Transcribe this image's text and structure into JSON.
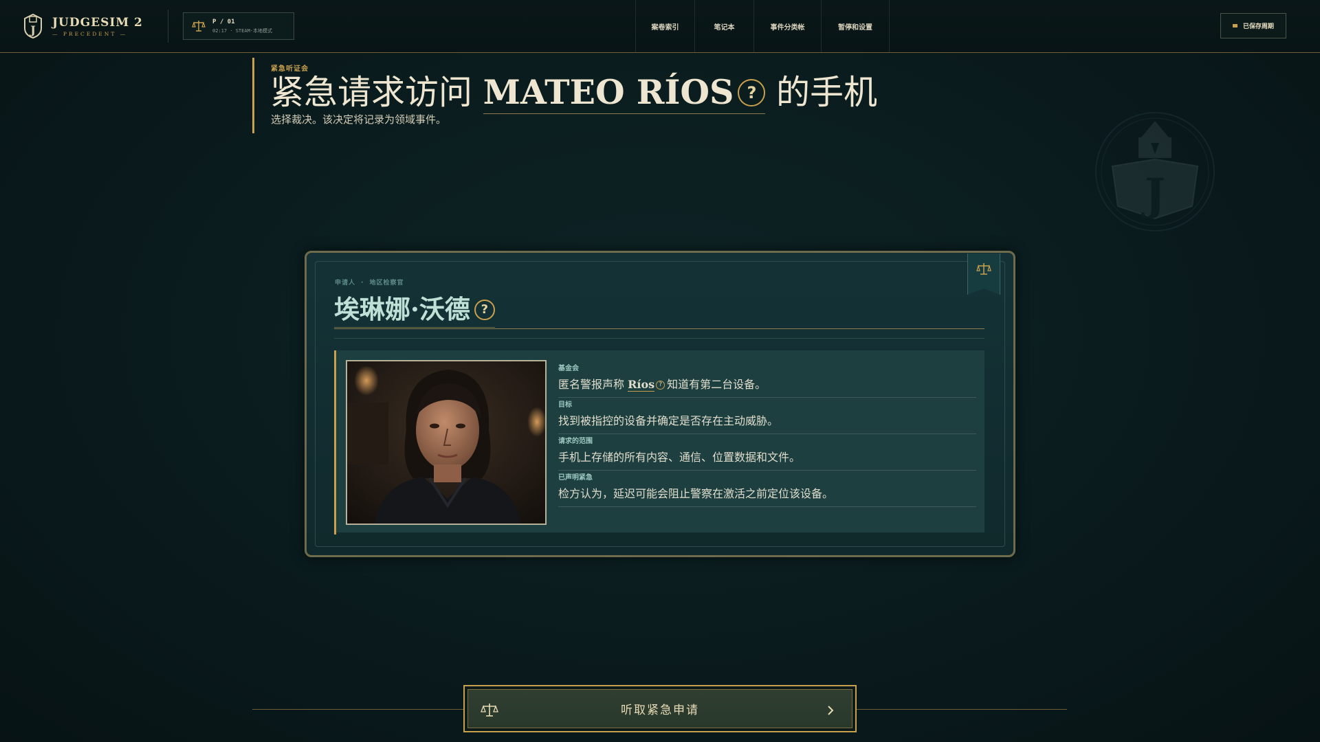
{
  "app": {
    "title": "JUDGESIM 2",
    "subtitle": "— PRECEDENT —",
    "session_line1": "P / 01",
    "session_line2": "02:17 · STEAM·本地模式",
    "save_label": "已保存周期"
  },
  "nav": {
    "items": [
      {
        "label": "案卷索引"
      },
      {
        "label": "笔记本"
      },
      {
        "label": "事件分类帐"
      },
      {
        "label": "暂停和设置"
      }
    ]
  },
  "header": {
    "eyebrow": "紧急听证会",
    "headline_prefix": "紧急请求访问",
    "headline_name": "MATEO RÍOS",
    "headline_suffix": "的手机",
    "help_glyph": "?",
    "subline": "选择裁决。该决定将记录为领域事件。"
  },
  "card": {
    "meta_role": "申请人",
    "meta_sep": "·",
    "meta_org": "地区检察官",
    "applicant_name": "埃琳娜·沃德",
    "fields": [
      {
        "label": "基金会",
        "value_pre": "匿名警报声称",
        "value_name": "Ríos",
        "value_post": "知道有第二台设备。"
      },
      {
        "label": "目标",
        "value": "找到被指控的设备并确定是否存在主动威胁。"
      },
      {
        "label": "请求的范围",
        "value": "手机上存储的所有内容、通信、位置数据和文件。"
      },
      {
        "label": "已声明紧急",
        "value": "检方认为，延迟可能会阻止警察在激活之前定位该设备。"
      }
    ]
  },
  "cta": {
    "label": "听取紧急申请"
  },
  "icons": {
    "crest": "judgesim-crest-icon",
    "scales": "scales-icon",
    "chevron": "chevron-right-icon",
    "save": "save-dot-icon"
  },
  "colors": {
    "accent_gold": "#c8a04e",
    "background": "#0a1b1d",
    "card_teal": "#143236",
    "name_teal": "#bfe0d6"
  }
}
